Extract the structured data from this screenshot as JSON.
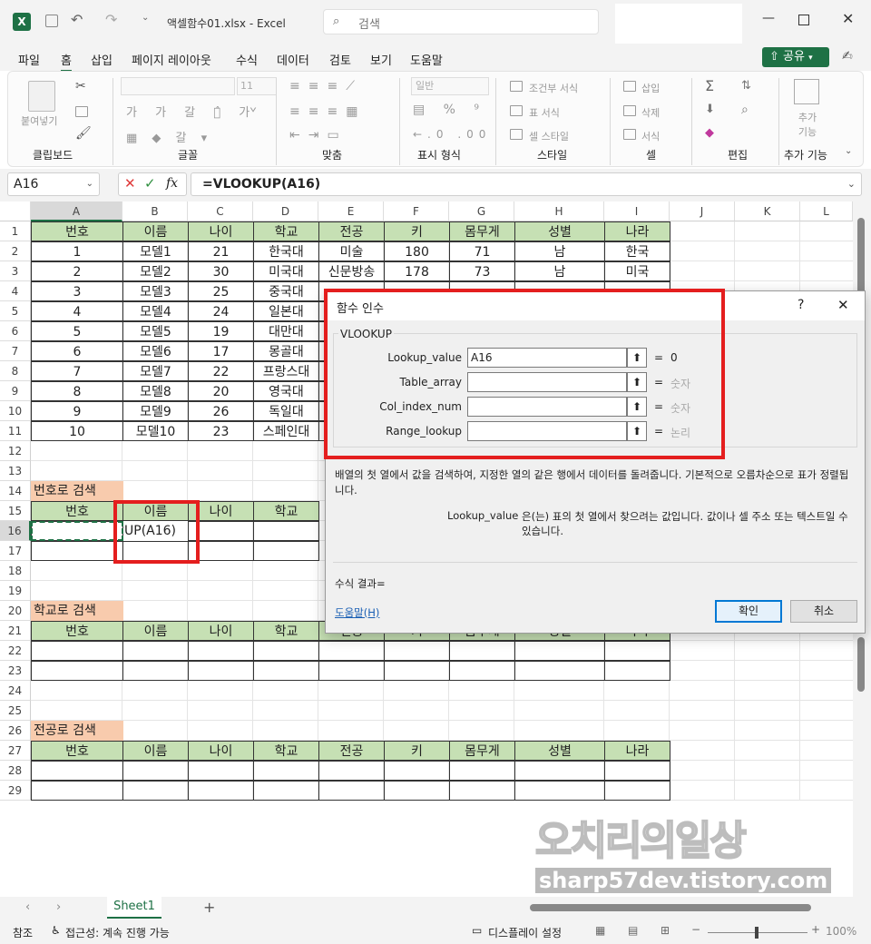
{
  "window": {
    "title": "액셀함수01.xlsx - Excel",
    "search_placeholder": "검색"
  },
  "menu": {
    "tabs": [
      "파일",
      "홈",
      "삽입",
      "페이지 레이아웃",
      "수식",
      "데이터",
      "검토",
      "보기",
      "도움말"
    ],
    "share_label": "공유"
  },
  "ribbon": {
    "paste_label": "붙여넣기",
    "font_size": "11",
    "number_format": "일반",
    "cond_format": "조건부 서식",
    "table_format": "표 서식",
    "cell_style": "셀 스타일",
    "insert": "삽입",
    "delete": "삭제",
    "format": "서식",
    "addins": "추가 기능",
    "groups": [
      "클립보드",
      "글꼴",
      "맞춤",
      "표시 형식",
      "스타일",
      "셀",
      "편집",
      "추가 기능"
    ]
  },
  "formula_bar": {
    "name_box": "A16",
    "formula": "=VLOOKUP(A16)",
    "fx": "fx"
  },
  "columns": [
    "A",
    "B",
    "C",
    "D",
    "E",
    "F",
    "G",
    "H",
    "I",
    "J",
    "K",
    "L"
  ],
  "rows": [
    "1",
    "2",
    "3",
    "4",
    "5",
    "6",
    "7",
    "8",
    "9",
    "10",
    "11",
    "12",
    "13",
    "14",
    "15",
    "16",
    "17",
    "18",
    "19",
    "20",
    "21",
    "22",
    "23",
    "24",
    "25",
    "26",
    "27",
    "28",
    "29"
  ],
  "table_headers": [
    "번호",
    "이름",
    "나이",
    "학교",
    "전공",
    "키",
    "몸무게",
    "성별",
    "나라"
  ],
  "table_rows": [
    [
      "1",
      "모델1",
      "21",
      "한국대",
      "미술",
      "180",
      "71",
      "남",
      "한국"
    ],
    [
      "2",
      "모델2",
      "30",
      "미국대",
      "신문방송",
      "178",
      "73",
      "남",
      "미국"
    ],
    [
      "3",
      "모델3",
      "25",
      "중국대",
      "",
      "",
      "",
      "",
      ""
    ],
    [
      "4",
      "모델4",
      "24",
      "일본대",
      "",
      "",
      "",
      "",
      ""
    ],
    [
      "5",
      "모델5",
      "19",
      "대만대",
      "",
      "",
      "",
      "",
      ""
    ],
    [
      "6",
      "모델6",
      "17",
      "몽골대",
      "",
      "",
      "",
      "",
      ""
    ],
    [
      "7",
      "모델7",
      "22",
      "프랑스대",
      "",
      "",
      "",
      "",
      ""
    ],
    [
      "8",
      "모델8",
      "20",
      "영국대",
      "",
      "",
      "",
      "",
      ""
    ],
    [
      "9",
      "모델9",
      "26",
      "독일대",
      "",
      "",
      "",
      "",
      ""
    ],
    [
      "10",
      "모델10",
      "23",
      "스페인대",
      "",
      "",
      "",
      "",
      ""
    ]
  ],
  "sections": {
    "s1_label": "번호로 검색",
    "s2_label": "학교로 검색",
    "s3_label": "전공로 검색",
    "b16_value": "UP(A16)",
    "s1_headers": [
      "번호",
      "이름",
      "나이",
      "학교"
    ],
    "s2_headers": [
      "번호",
      "이름",
      "나이",
      "학교",
      "전공",
      "키",
      "몸무게",
      "성별",
      "나라"
    ]
  },
  "dialog": {
    "title": "함수 인수",
    "help_char": "?",
    "close_char": "✕",
    "function_name": "VLOOKUP",
    "args": [
      {
        "name": "Lookup_value",
        "value": "A16",
        "result": "0"
      },
      {
        "name": "Table_array",
        "value": "",
        "result": "숫자"
      },
      {
        "name": "Col_index_num",
        "value": "",
        "result": "숫자"
      },
      {
        "name": "Range_lookup",
        "value": "",
        "result": "논리"
      }
    ],
    "description": "배열의 첫 열에서 값을 검색하여, 지정한 열의 같은 행에서 데이터를 돌려줍니다. 기본적으로 오름차순으로 표가 정렬됩니다.",
    "arg_desc_name": "Lookup_value",
    "arg_desc": "은(는) 표의 첫 열에서 찾으려는 값입니다. 값이나 셀 주소 또는 텍스트일 수 있습니다.",
    "result_label": "수식 결과=",
    "help_link": "도움말(H)",
    "ok": "확인",
    "cancel": "취소"
  },
  "sheet": {
    "tab": "Sheet1",
    "add": "+"
  },
  "status": {
    "mode": "참조",
    "accessibility": "접근성: 계속 진행 가능",
    "display": "디스플레이 설정",
    "zoom": "100%"
  },
  "watermark": {
    "line1": "오치리의일상",
    "line2": "sharp57dev.tistory.com"
  },
  "colors": {
    "header_green": "#c6e0b4",
    "label_orange": "#f8cbad",
    "excel_green": "#1e7145",
    "red_highlight": "#e41e1e"
  }
}
